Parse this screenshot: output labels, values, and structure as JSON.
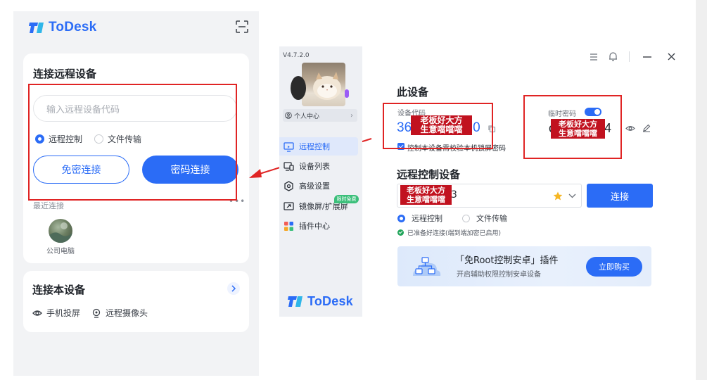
{
  "mobile": {
    "brand": "ToDesk",
    "connect_card": {
      "title": "连接远程设备",
      "input_placeholder": "输入远程设备代码",
      "options": [
        "远程控制",
        "文件传输"
      ],
      "selected_option": "远程控制",
      "btn_no_password": "免密连接",
      "btn_password": "密码连接",
      "recent_label": "最近连接",
      "more": "•••",
      "recent_devices": [
        {
          "name": "公司电脑"
        }
      ]
    },
    "local_card": {
      "title": "连接本设备",
      "items": [
        "手机投屏",
        "远程摄像头"
      ]
    }
  },
  "desktop": {
    "version": "V4.7.2.0",
    "profile": "个人中心",
    "nav": [
      {
        "label": "远程控制",
        "active": true
      },
      {
        "label": "设备列表",
        "active": false
      },
      {
        "label": "高级设置",
        "active": false
      },
      {
        "label": "镜像屏/扩展屏",
        "active": false,
        "badge": "限时免费"
      },
      {
        "label": "插件中心",
        "active": false
      }
    ],
    "brand": "ToDesk",
    "this_device": {
      "title": "此设备",
      "code_label": "设备代码",
      "code_visible_start": "36",
      "code_visible_end": "0",
      "temp_password_label": "临时密码",
      "temp_password_visible_start": "c",
      "temp_password_visible_end": "4",
      "require_lock_password": "控制本设备需校验本机锁屏密码"
    },
    "remote": {
      "title": "远程控制设备",
      "input_visible_end": "3",
      "connect": "连接",
      "options": [
        "远程控制",
        "文件传输"
      ],
      "selected_option": "远程控制",
      "status": "已准备好连接(端到端加密已启用)"
    },
    "banner": {
      "title": "「免Root控制安卓」插件",
      "subtitle": "开启辅助权限控制安卓设备",
      "button": "立即购买"
    }
  },
  "watermark": {
    "line1": "老板好大方",
    "line2": "生意噹噹噹"
  },
  "colors": {
    "accent": "#2b6cf6",
    "annotation": "#e02424",
    "watermark_bg": "#c1121f"
  }
}
